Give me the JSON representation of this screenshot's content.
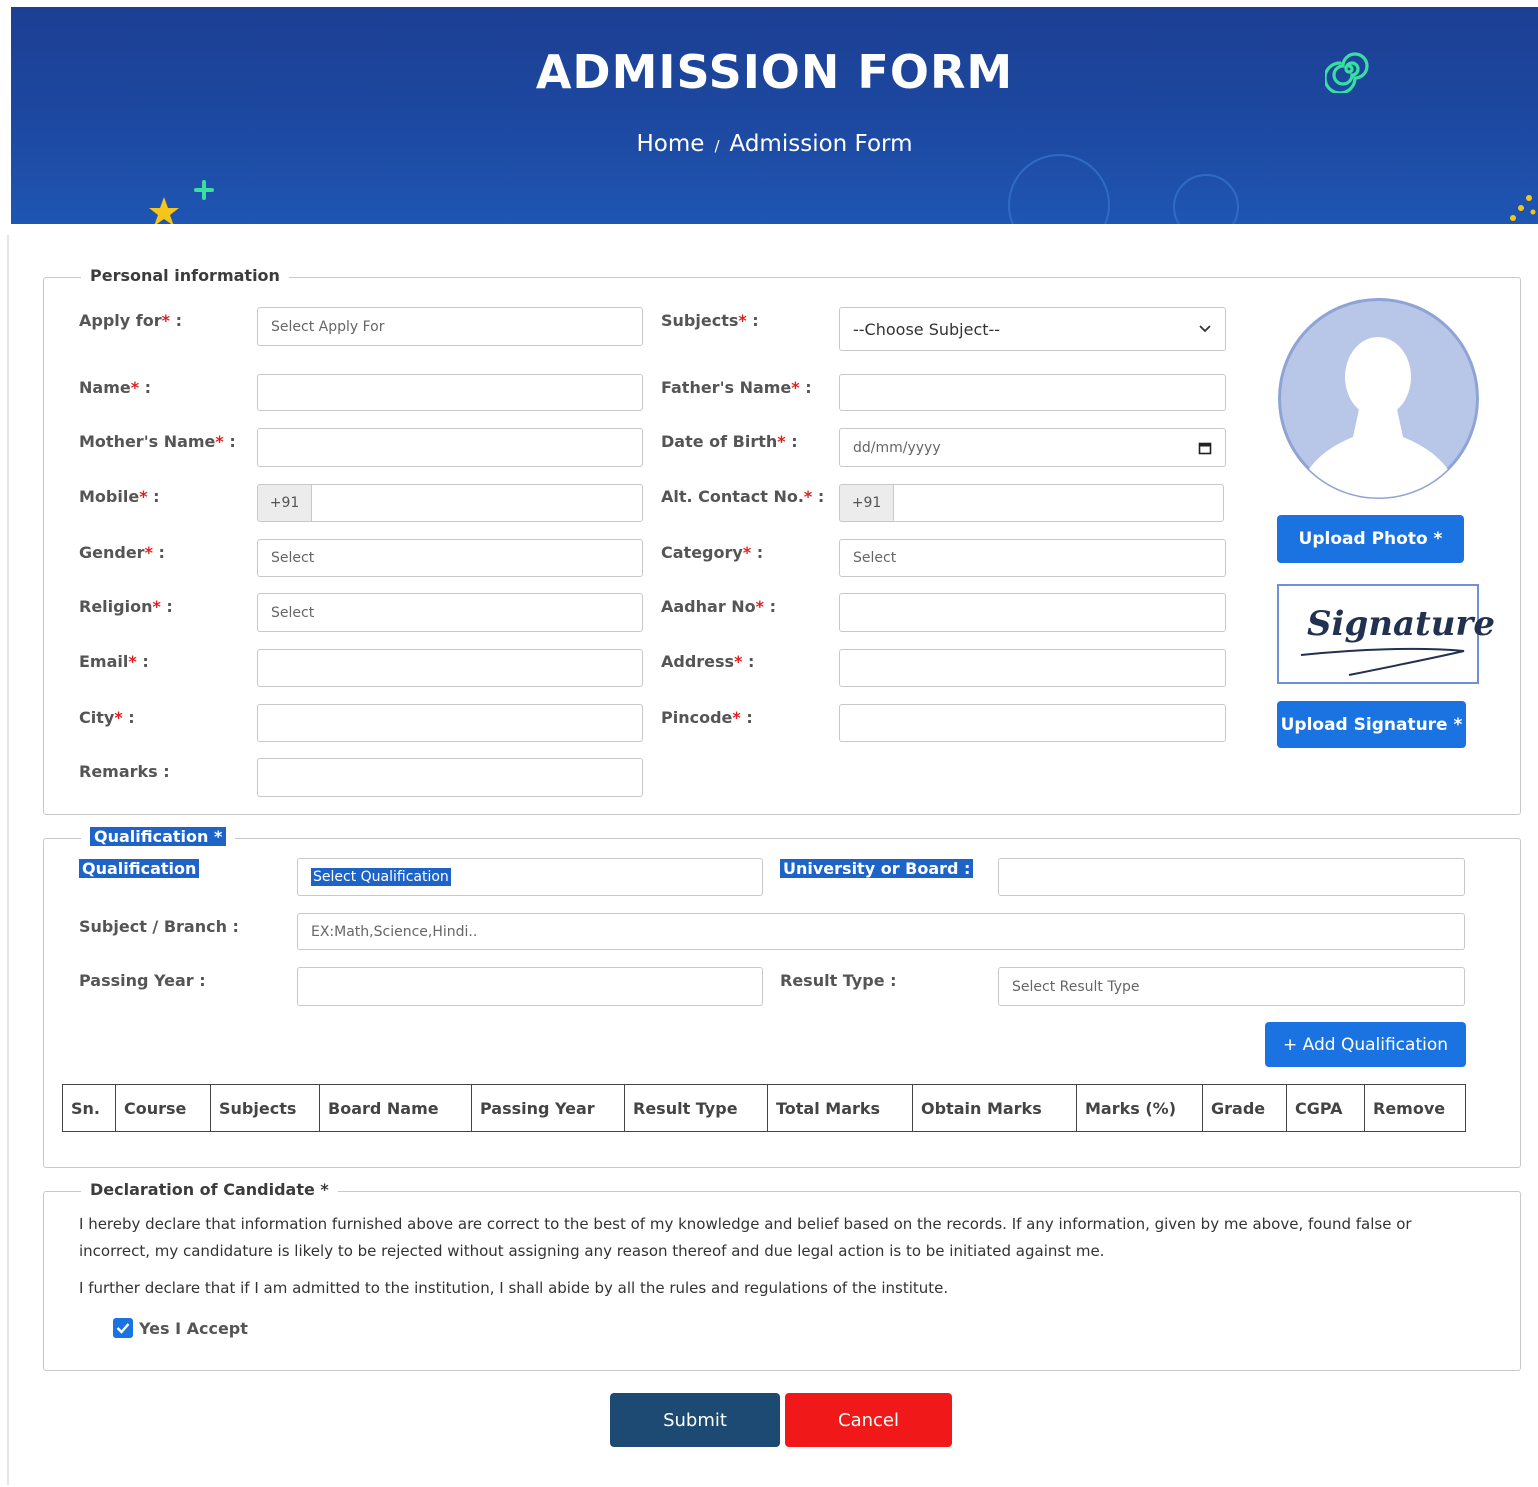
{
  "header": {
    "title": "ADMISSION FORM",
    "breadcrumb_home": "Home",
    "breadcrumb_sep": "/",
    "breadcrumb_current": "Admission Form"
  },
  "personal": {
    "legend": "Personal information",
    "apply_for": {
      "label": "Apply for",
      "placeholder": "Select Apply For"
    },
    "subjects": {
      "label": "Subjects",
      "selected": "--Choose Subject--"
    },
    "name": {
      "label": "Name",
      "value": ""
    },
    "fathers_name": {
      "label": "Father's Name",
      "value": ""
    },
    "mothers_name": {
      "label": "Mother's Name",
      "value": ""
    },
    "dob": {
      "label": "Date of Birth",
      "placeholder": "dd/mm/yyyy"
    },
    "mobile": {
      "label": "Mobile",
      "prefix": "+91",
      "value": ""
    },
    "alt_contact": {
      "label": "Alt. Contact No.",
      "prefix": "+91",
      "value": ""
    },
    "gender": {
      "label": "Gender",
      "placeholder": "Select"
    },
    "category": {
      "label": "Category",
      "placeholder": "Select"
    },
    "religion": {
      "label": "Religion",
      "placeholder": "Select"
    },
    "aadhar": {
      "label": "Aadhar No",
      "value": ""
    },
    "email": {
      "label": "Email",
      "value": ""
    },
    "address": {
      "label": "Address",
      "value": ""
    },
    "city": {
      "label": "City",
      "value": ""
    },
    "pincode": {
      "label": "Pincode",
      "value": ""
    },
    "remarks": {
      "label": "Remarks",
      "value": ""
    },
    "upload_photo": "Upload Photo *",
    "signature_text": "Signature",
    "upload_signature": "Upload Signature *"
  },
  "qualification": {
    "legend": "Qualification *",
    "qualification_label": "Qualification",
    "qualification_placeholder": "Select Qualification",
    "university_label": "University or Board :",
    "subject_label": "Subject / Branch :",
    "subject_placeholder": "EX:Math,Science,Hindi..",
    "passing_year_label": "Passing Year :",
    "result_type_label": "Result Type :",
    "result_type_placeholder": "Select Result Type",
    "add_button": "+ Add Qualification",
    "table_headers": [
      "Sn.",
      "Course",
      "Subjects",
      "Board Name",
      "Passing Year",
      "Result Type",
      "Total Marks",
      "Obtain Marks",
      "Marks (%)",
      "Grade",
      "CGPA",
      "Remove"
    ]
  },
  "declaration": {
    "legend": "Declaration of Candidate *",
    "para1": "I hereby declare that information furnished above are correct to the best of my knowledge and belief based on the records. If any information, given by me above, found false or incorrect, my candidature is likely to be rejected without assigning any reason thereof and due legal action is to be initiated against me.",
    "para2": "I further declare that if I am admitted to the institution, I shall abide by all the rules and regulations of the institute.",
    "accept_label": "Yes I Accept",
    "accepted": true
  },
  "actions": {
    "submit": "Submit",
    "cancel": "Cancel"
  },
  "colors": {
    "banner": "#1d4aa3",
    "primary_button": "#1a73e0",
    "submit": "#1d4a73",
    "cancel": "#f01818",
    "required": "#e02020"
  }
}
